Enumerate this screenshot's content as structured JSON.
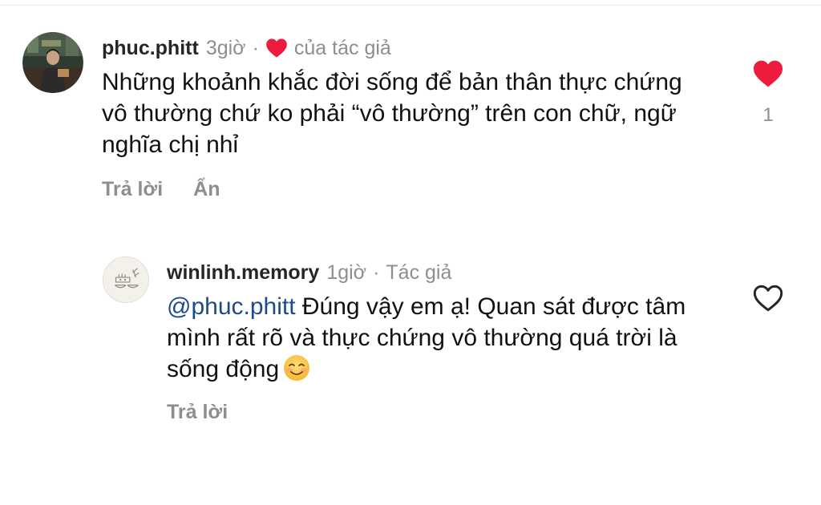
{
  "comments": [
    {
      "username": "phuc.phitt",
      "time": "3giờ",
      "separator": "·",
      "author_like_label": "của tác giả",
      "text": "Những khoảnh khắc đời sống để bản thân thực chứng vô thường chứ ko phải “vô thường” trên con chữ, ngữ nghĩa chị nhỉ",
      "actions": {
        "reply": "Trả lời",
        "hide": "Ẩn"
      },
      "like_count": "1",
      "liked": true,
      "heart_color": "#ed1c3c"
    }
  ],
  "reply": {
    "username": "winlinh.memory",
    "time": "1giờ",
    "separator": "·",
    "author_tag": "Tác giả",
    "mention": "@phuc.phitt",
    "text": " Đúng vậy em ạ! Quan sát được tâm mình rất rõ và thực chứng vô thường quá trời là sống động",
    "emoji_icon": "smiling-face-icon",
    "actions": {
      "reply": "Trả lời"
    },
    "liked": false
  },
  "colors": {
    "mention": "#1e4a8c",
    "secondary_text": "#8e8e8e",
    "primary_text": "#111111"
  }
}
